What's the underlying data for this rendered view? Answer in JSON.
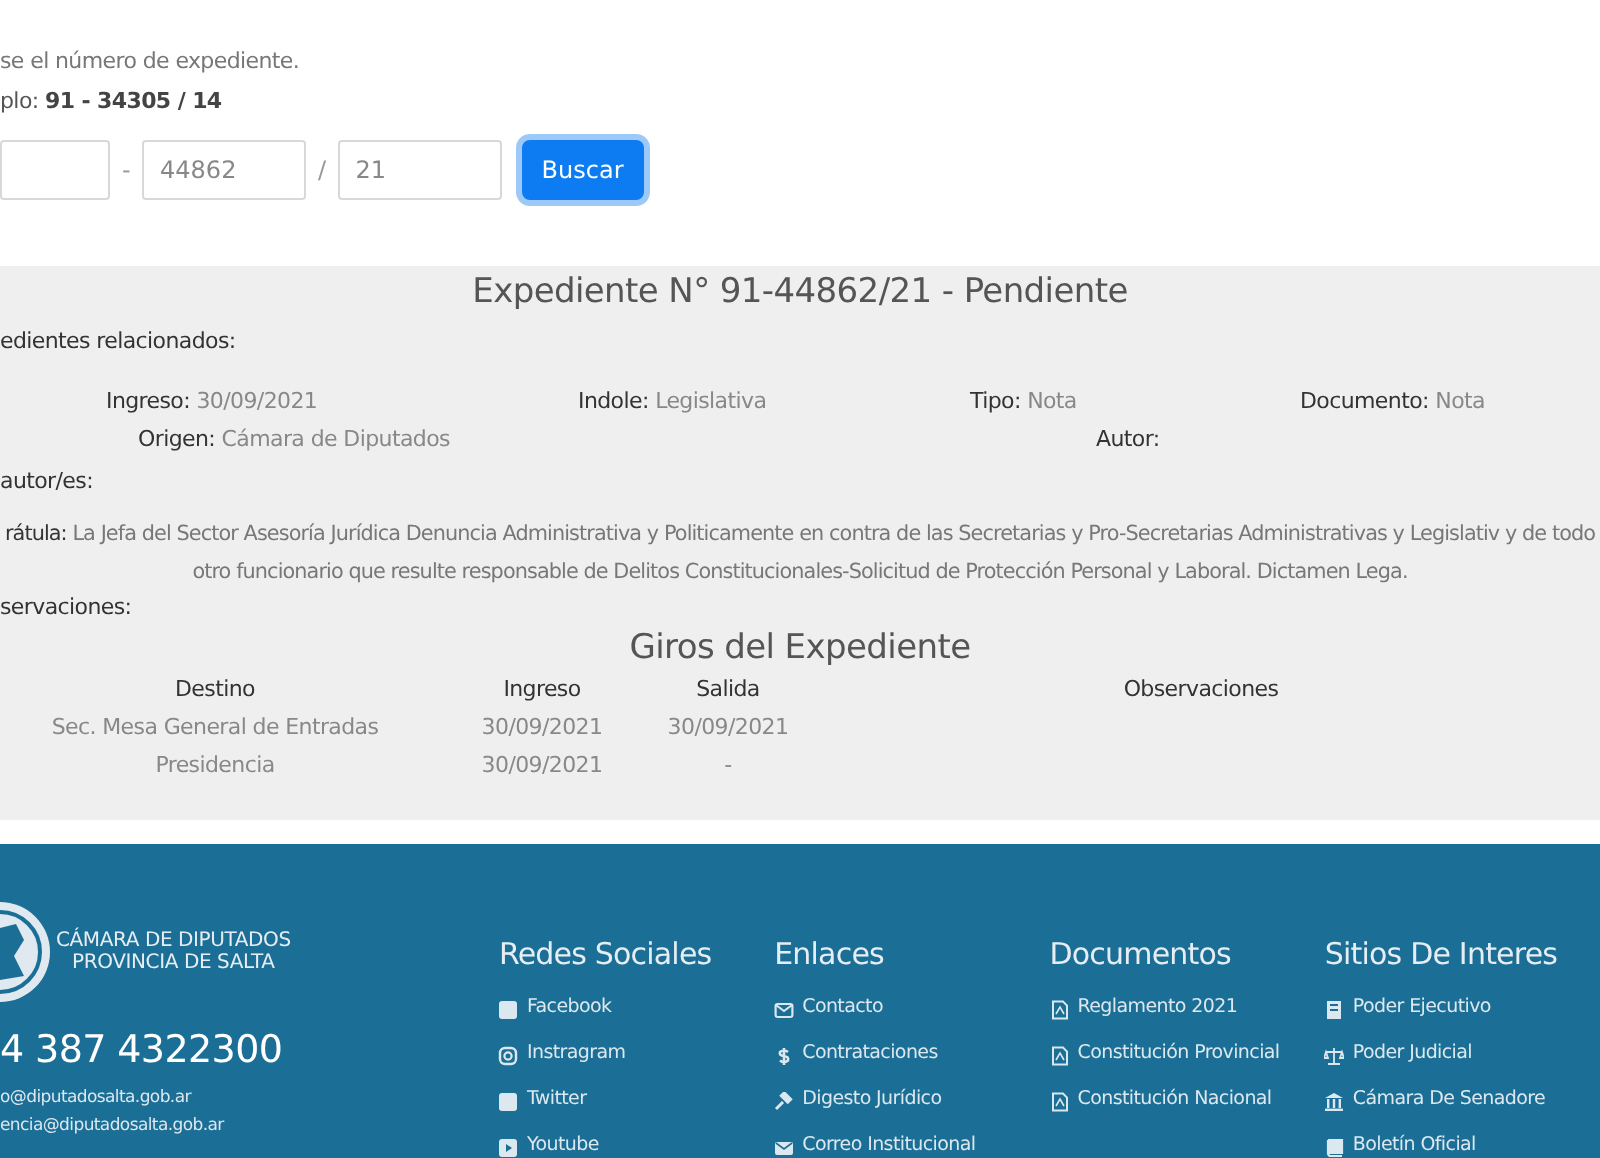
{
  "search": {
    "instructions": "se el número de expediente.",
    "example_label": "plo:",
    "example_value": "91 - 34305 / 14",
    "fields": [
      {
        "kind": "empty"
      },
      {
        "kind": "filled",
        "value": "44862"
      },
      {
        "kind": "filled",
        "value": "21"
      }
    ],
    "separators": [
      "-",
      "/"
    ],
    "button": "Buscar"
  },
  "expediente": {
    "title": "Expediente N° 91-44862/21 - Pendiente",
    "related_label": "edientes relacionados:",
    "details": [
      {
        "label": "Ingreso:",
        "value": "30/09/2021"
      },
      {
        "label": "Indole:",
        "value": "Legislativa"
      },
      {
        "label": "Tipo:",
        "value": "Nota"
      },
      {
        "label": "Documento:",
        "value": "Nota"
      }
    ],
    "details_2": [
      {
        "label": "Origen:",
        "value": "Cámara de Diputados"
      },
      {
        "label": "Autor:"
      }
    ],
    "coautores_label": "autor/es:",
    "caratula_label": "rátula:",
    "caratula": "La Jefa del Sector Asesoría Jurídica Denuncia Administrativa y Politicamente en contra de las Secretarias y Pro-Secretarias Administrativas y Legislativ y de todo otro funcionario que resulte responsable de Delitos Constitucionales-Solicitud de Protección Personal y Laboral. Dictamen Lega.",
    "observaciones_label": "servaciones:"
  },
  "giros": {
    "title": "Giros del Expediente",
    "columns": [
      "Destino",
      "Ingreso",
      "Salida",
      "Observaciones"
    ],
    "rows": [
      [
        "Sec. Mesa General de Entradas",
        "30/09/2021",
        "30/09/2021",
        ""
      ],
      [
        "Presidencia",
        "30/09/2021",
        "-",
        ""
      ]
    ]
  },
  "footer": {
    "logo_text": [
      "CÁMARA DE DIPUTADOS",
      "PROVINCIA DE SALTA"
    ],
    "phone": "4 387 4322300",
    "emails": [
      "o@diputadosalta.gob.ar",
      "encia@diputadosalta.gob.ar"
    ],
    "columns": [
      {
        "title": "Redes Sociales",
        "links": [
          "Facebook",
          "Instragram",
          "Twitter",
          "Youtube"
        ]
      },
      {
        "title": "Enlaces",
        "links": [
          "Contacto",
          "Contrataciones",
          "Digesto Jurídico",
          "Correo Institucional"
        ]
      },
      {
        "title": "Documentos",
        "links": [
          "Reglamento 2021",
          "Constitución Provincial",
          "Constitución Nacional"
        ]
      },
      {
        "title": "Sitios De Interes",
        "links": [
          "Poder Ejecutivo",
          "Poder Judicial",
          "Cámara De Senadore",
          "Boletín Oficial"
        ]
      }
    ]
  }
}
